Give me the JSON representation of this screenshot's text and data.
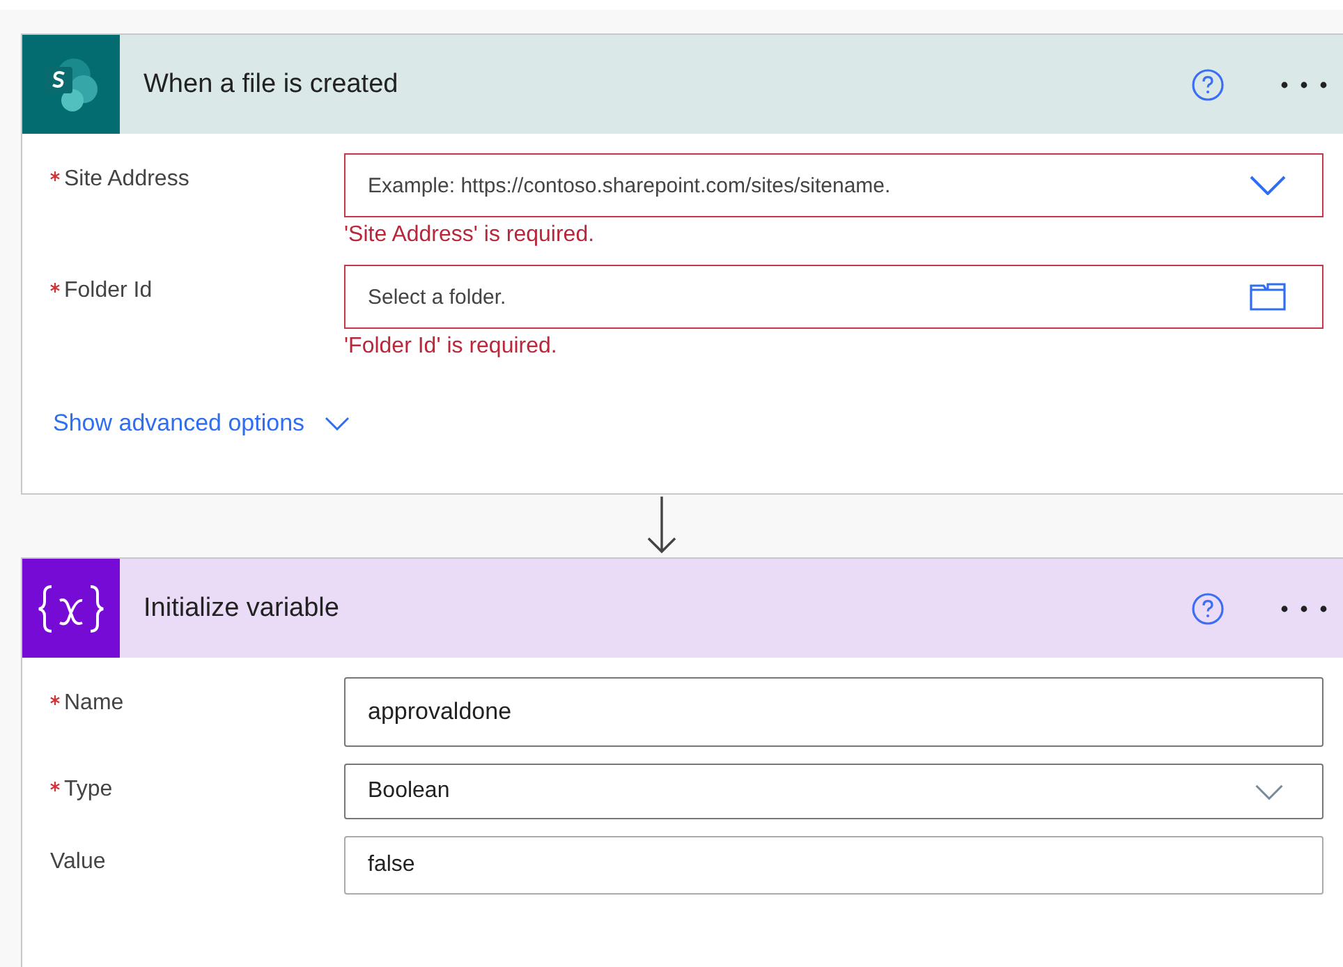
{
  "cards": [
    {
      "kind": "sharepoint",
      "title": "When a file is created",
      "fields": [
        {
          "label": "Site Address",
          "required": true,
          "kind": "dropdown",
          "placeholder": "Example: https://contoso.sharepoint.com/sites/sitename.",
          "error": "'Site Address' is required."
        },
        {
          "label": "Folder Id",
          "required": true,
          "kind": "folder",
          "placeholder": "Select a folder.",
          "error": "'Folder Id' is required."
        }
      ],
      "advanced": "Show advanced options"
    },
    {
      "kind": "variable",
      "title": "Initialize variable",
      "fields": [
        {
          "label": "Name",
          "required": true,
          "kind": "text",
          "value": "approvaldone"
        },
        {
          "label": "Type",
          "required": true,
          "kind": "dropdown",
          "value": "Boolean"
        },
        {
          "label": "Value",
          "required": false,
          "kind": "text",
          "value": "false"
        }
      ]
    }
  ]
}
